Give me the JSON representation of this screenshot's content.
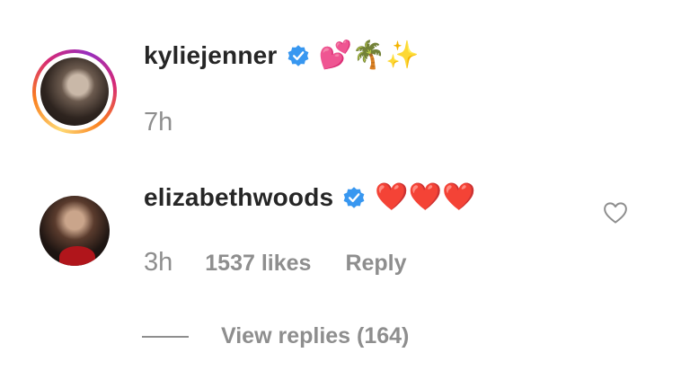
{
  "comments": [
    {
      "username": "kyliejenner",
      "verified": true,
      "text": "💕🌴✨",
      "time": "7h",
      "avatar_ring": "instagram-story-gradient"
    },
    {
      "username": "elizabethwoods",
      "verified": true,
      "text": "❤️❤️❤️",
      "time": "3h",
      "likes": "1537 likes",
      "reply_label": "Reply",
      "view_replies": "View replies (164)",
      "like_icon": "heart-outline-icon"
    }
  ],
  "colors": {
    "primary_text": "#262626",
    "secondary_text": "#8e8e8e",
    "verified_blue": "#3897f0"
  }
}
